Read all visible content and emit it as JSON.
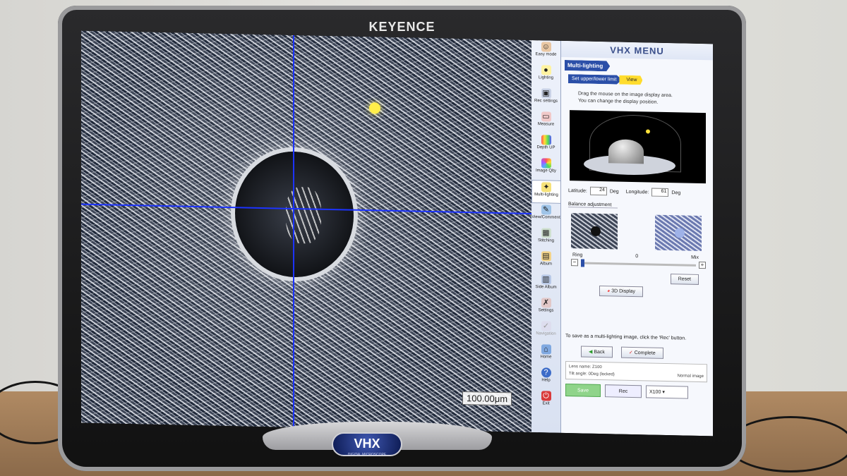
{
  "monitor": {
    "brand": "KEYENCE",
    "logo": "VHX",
    "logo_sub": "DIGITAL MICROSCOPE"
  },
  "image": {
    "scale": "100.00μm"
  },
  "sidebar": {
    "items": [
      {
        "label": "Easy mode",
        "icon": "person-icon"
      },
      {
        "label": "Lighting",
        "icon": "bulb-icon"
      },
      {
        "label": "Rec settings",
        "icon": "camera-icon"
      },
      {
        "label": "Measure",
        "icon": "ruler-icon"
      },
      {
        "label": "Depth UP",
        "icon": "rainbow-icon"
      },
      {
        "label": "Image Qlty",
        "icon": "palette-icon"
      },
      {
        "label": "Multi-lighting",
        "icon": "multi-light-icon",
        "active": true
      },
      {
        "label": "View/Comment",
        "icon": "comment-icon"
      },
      {
        "label": "Stitching",
        "icon": "stitch-icon"
      },
      {
        "label": "Album",
        "icon": "album-icon"
      },
      {
        "label": "Side Album",
        "icon": "side-album-icon"
      },
      {
        "label": "Settings",
        "icon": "wrench-icon"
      },
      {
        "label": "Navigation",
        "icon": "navigation-icon"
      },
      {
        "label": "Home",
        "icon": "home-icon"
      },
      {
        "label": "Help",
        "icon": "help-icon"
      },
      {
        "label": "Exit",
        "icon": "power-icon"
      }
    ]
  },
  "panel": {
    "title": "VHX MENU",
    "section": "Multi-lighting",
    "steps": [
      "Set upper/lower limit",
      "View"
    ],
    "instruction_1": "Drag the mouse on the image display area.",
    "instruction_2": "You can change the display position.",
    "latitude_label": "Latitude:",
    "latitude_value": "24",
    "longitude_label": "Longitude:",
    "longitude_value": "61",
    "deg": "Deg",
    "balance_label": "Balance adjustment",
    "ring_label": "Ring",
    "mix_label": "Mix",
    "slider_value": "0",
    "reset": "Reset",
    "display_3d": "3D Display",
    "save_note": "To save as a multi-lighting image, click the 'Rec' button.",
    "back": "Back",
    "complete": "Complete",
    "lens_name": "Lens name: Z100",
    "tilt_angle": "Tilt angle: 0Deg (locked)",
    "normal_image": "Normal image",
    "save": "Save",
    "rec": "Rec",
    "zoom": "X100"
  }
}
